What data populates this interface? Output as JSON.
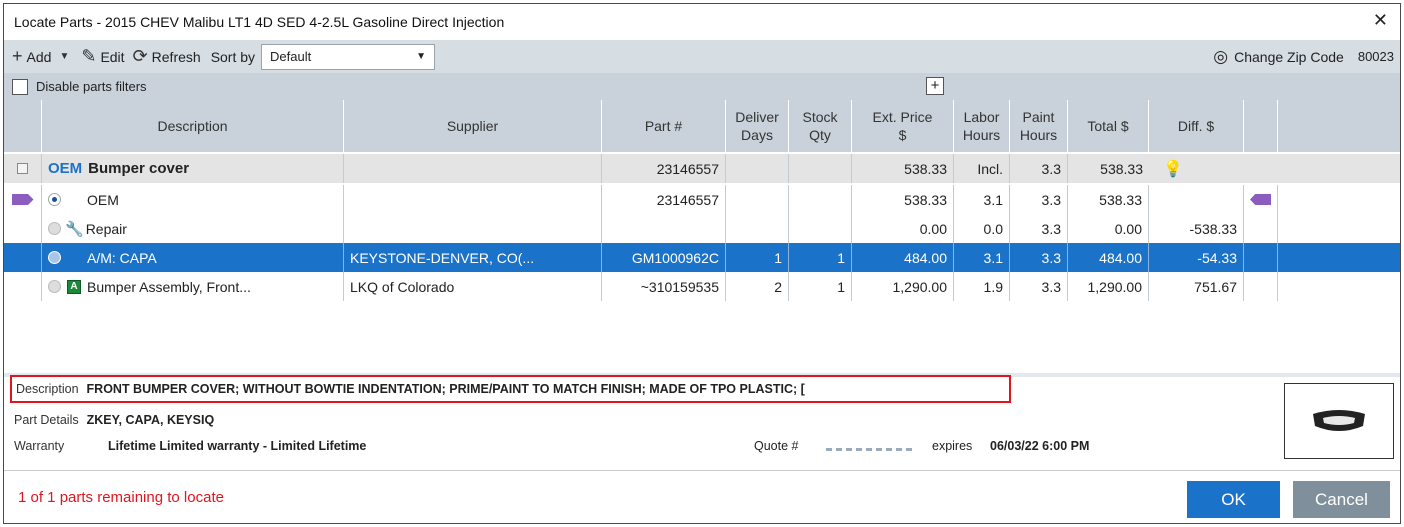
{
  "window": {
    "title": "Locate Parts - 2015 CHEV Malibu LT1 4D SED 4-2.5L Gasoline Direct Injection",
    "close_glyph": "✕"
  },
  "toolbar": {
    "add_label": "Add",
    "edit_label": "Edit",
    "refresh_label": "Refresh",
    "sort_label": "Sort by",
    "sort_value": "Default",
    "change_zip_label": "Change Zip Code",
    "zip_value": "80023"
  },
  "filters": {
    "disable_label": "Disable parts filters"
  },
  "columns": {
    "description": "Description",
    "supplier": "Supplier",
    "part": "Part #",
    "deliver_1": "Deliver",
    "deliver_2": "Days",
    "stock_1": "Stock",
    "stock_2": "Qty",
    "ext_1": "Ext. Price",
    "ext_2": "$",
    "labor_1": "Labor",
    "labor_2": "Hours",
    "paint_1": "Paint",
    "paint_2": "Hours",
    "total": "Total $",
    "diff": "Diff. $"
  },
  "group": {
    "oem_tag": "OEM",
    "name": "Bumper cover",
    "part": "23146557",
    "ext": "538.33",
    "labor": "Incl.",
    "paint": "3.3",
    "total": "538.33"
  },
  "rows": [
    {
      "desc": "OEM",
      "supplier": "",
      "part": "23146557",
      "deliver": "",
      "stock": "",
      "ext": "538.33",
      "labor": "3.1",
      "paint": "3.3",
      "total": "538.33",
      "diff": ""
    },
    {
      "desc": "Repair",
      "supplier": "",
      "part": "",
      "deliver": "",
      "stock": "",
      "ext": "0.00",
      "labor": "0.0",
      "paint": "3.3",
      "total": "0.00",
      "diff": "-538.33"
    },
    {
      "desc": "A/M: CAPA",
      "supplier": "KEYSTONE-DENVER, CO(...",
      "part": "GM1000962C",
      "deliver": "1",
      "stock": "1",
      "ext": "484.00",
      "labor": "3.1",
      "paint": "3.3",
      "total": "484.00",
      "diff": "-54.33"
    },
    {
      "desc": "Bumper Assembly, Front...",
      "supplier": "LKQ of Colorado",
      "part": "~310159535",
      "deliver": "2",
      "stock": "1",
      "ext": "1,290.00",
      "labor": "1.9",
      "paint": "3.3",
      "total": "1,290.00",
      "diff": "751.67",
      "badge": "A"
    }
  ],
  "details": {
    "description_label": "Description",
    "description_value": "FRONT BUMPER COVER; WITHOUT BOWTIE INDENTATION; PRIME/PAINT TO MATCH FINISH; MADE OF TPO PLASTIC; [",
    "part_details_label": "Part Details",
    "part_details_value": "ZKEY, CAPA, KEYSIQ",
    "warranty_label": "Warranty",
    "warranty_value": "Lifetime Limited warranty - Limited Lifetime",
    "quote_label": "Quote #",
    "expires_label": "expires",
    "expires_value": "06/03/22 6:00 PM"
  },
  "footer": {
    "remaining": "1 of 1 parts remaining to locate",
    "ok_label": "OK",
    "cancel_label": "Cancel"
  },
  "colors": {
    "selection": "#1b73c9",
    "tag": "#8b5dbf",
    "alert_red": "#e0161e",
    "header_bg": "#c9d2da"
  }
}
